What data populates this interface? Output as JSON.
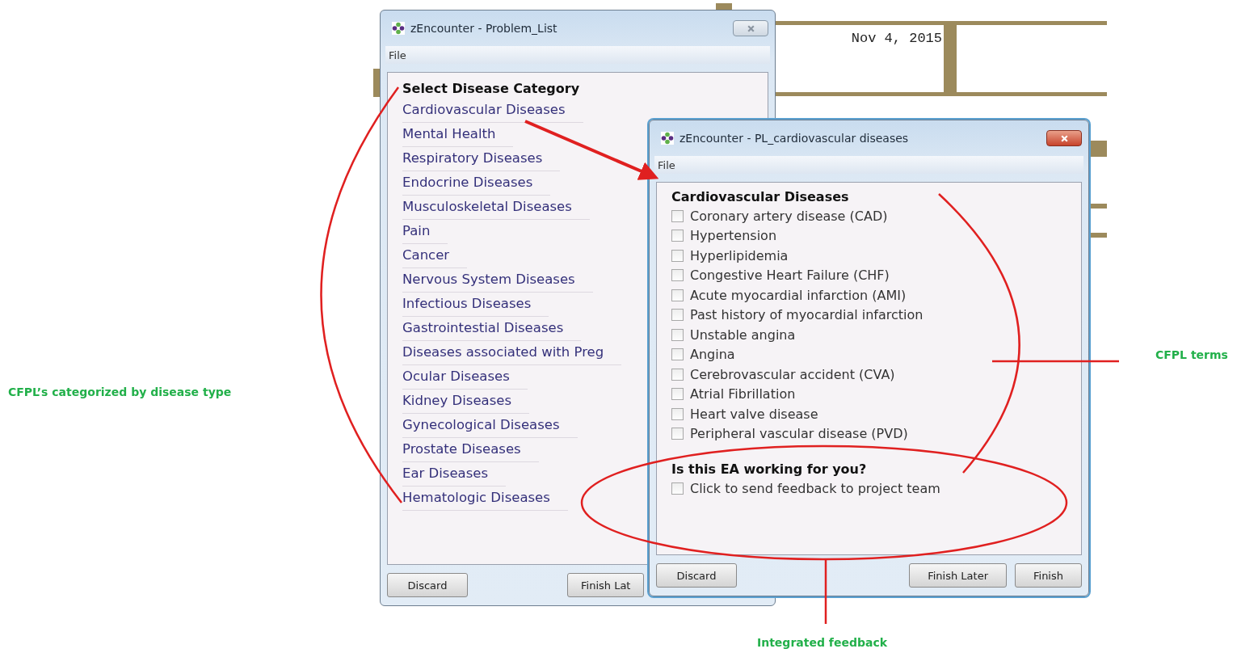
{
  "background_app": {
    "date": "Nov 4, 2015"
  },
  "windows": [
    {
      "title": "zEncounter - Problem_List",
      "active": false,
      "menu": [
        "File"
      ],
      "heading": "Select Disease Category",
      "kind": "links",
      "items": [
        {
          "label": "Cardiovascular Diseases"
        },
        {
          "label": "Mental Health"
        },
        {
          "label": "Respiratory Diseases"
        },
        {
          "label": "Endocrine Diseases"
        },
        {
          "label": "Musculoskeletal Diseases"
        },
        {
          "label": "Pain"
        },
        {
          "label": "Cancer"
        },
        {
          "label": "Nervous System Diseases"
        },
        {
          "label": "Infectious Diseases"
        },
        {
          "label": "Gastrointestial Diseases"
        },
        {
          "label": "Diseases associated with Preg"
        },
        {
          "label": "Ocular Diseases"
        },
        {
          "label": "Kidney Diseases"
        },
        {
          "label": "Gynecological Diseases"
        },
        {
          "label": "Prostate Diseases"
        },
        {
          "label": "Ear Diseases"
        },
        {
          "label": "Hematologic Diseases"
        }
      ],
      "buttons": [
        "Discard",
        "Finish Lat"
      ]
    },
    {
      "title": "zEncounter - PL_cardiovascular diseases",
      "active": true,
      "menu": [
        "File"
      ],
      "heading": "Cardiovascular Diseases",
      "kind": "checklist",
      "items": [
        {
          "label": "Coronary artery disease (CAD)",
          "checked": false
        },
        {
          "label": "Hypertension",
          "checked": false
        },
        {
          "label": "Hyperlipidemia",
          "checked": false
        },
        {
          "label": "Congestive Heart Failure (CHF)",
          "checked": false
        },
        {
          "label": "Acute myocardial infarction (AMI)",
          "checked": false
        },
        {
          "label": "Past history of myocardial infarction",
          "checked": false
        },
        {
          "label": "Unstable angina",
          "checked": false
        },
        {
          "label": "Angina",
          "checked": false
        },
        {
          "label": "Cerebrovascular accident (CVA)",
          "checked": false
        },
        {
          "label": "Atrial Fibrillation",
          "checked": false
        },
        {
          "label": "Heart valve disease",
          "checked": false
        },
        {
          "label": "Peripheral vascular disease (PVD)",
          "checked": false
        }
      ],
      "feedback": {
        "question": "Is this EA working for you?",
        "option": {
          "label": "Click to send feedback to project team",
          "checked": false
        }
      },
      "buttons": [
        "Discard",
        "Finish Later",
        "Finish"
      ]
    }
  ],
  "annotations": [
    {
      "text": "CFPL’s categorized by disease type",
      "kind": "left"
    },
    {
      "text": "CFPL terms",
      "kind": "right"
    },
    {
      "text": "Integrated feedback",
      "kind": "bottom"
    }
  ]
}
